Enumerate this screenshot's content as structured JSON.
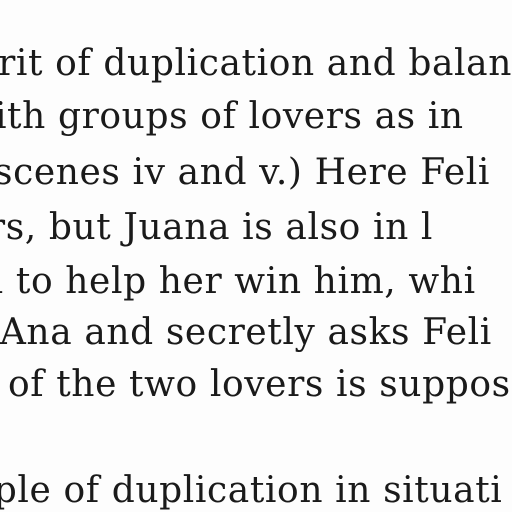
{
  "document": {
    "lines": [
      "irit of duplication and balan",
      "vith groups of lovers as in",
      "scenes iv and v.)   Here Feli",
      "ers, but Juana is also in l",
      "na to help her win him, whi",
      "n Ana and secretly asks Feli",
      "of the two lovers is suppose",
      "nple of duplication in situati"
    ]
  }
}
